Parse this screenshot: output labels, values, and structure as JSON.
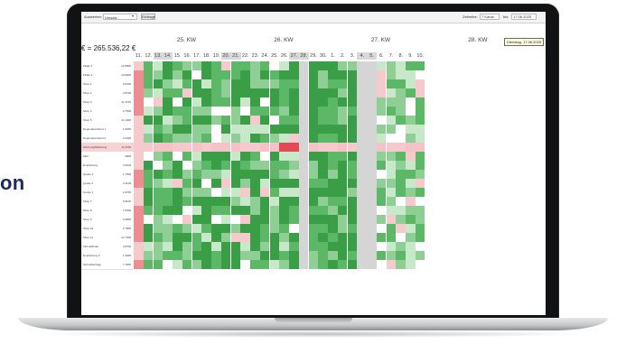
{
  "side_text": "on",
  "toolbar": {
    "label": "Auswerten:",
    "select_value": "Umsatz",
    "button": "Einfrage",
    "right_label": "Zeitreihe:",
    "right_select": "7 Kanal",
    "date_label": "bis:",
    "date_value": "17.06.2025"
  },
  "total": "€ = 265.536,22 €",
  "tooltip": "Dienstag, 17.06.2025",
  "weeks": [
    {
      "label": "25. KW",
      "col": 5
    },
    {
      "label": "26. KW",
      "col": 15
    },
    {
      "label": "27. KW",
      "col": 25
    },
    {
      "label": "28. KW",
      "col": 35
    }
  ],
  "days": [
    "11.",
    "12.",
    "13.",
    "14.",
    "15.",
    "16.",
    "17.",
    "18.",
    "19.",
    "20.",
    "21.",
    "22.",
    "23.",
    "24.",
    "25.",
    "26.",
    "27.",
    "28.",
    "29.",
    "30.",
    "1.",
    "2.",
    "3.",
    "4.",
    "5.",
    "6.",
    "7.",
    "8.",
    "9.",
    "10."
  ],
  "rows": [
    {
      "name": "Filiale 1",
      "value": "14.880€"
    },
    {
      "name": "Filiale 2",
      "value": "10.890€"
    },
    {
      "name": "Shop 1",
      "value": "9.630€"
    },
    {
      "name": "Shop 2",
      "value": "4.870€"
    },
    {
      "name": "Shop 3",
      "value": "11.470€"
    },
    {
      "name": "Shop 4",
      "value": "3.750€"
    },
    {
      "name": "Shop 5",
      "value": "11.440€"
    },
    {
      "name": "Regionalverband 1",
      "value": "1.840€"
    },
    {
      "name": "Regionalverband 2",
      "value": "3.340€"
    },
    {
      "name": "Werbung/Marketing",
      "value": "11.670€"
    },
    {
      "name": "Mail",
      "value": "980€"
    },
    {
      "name": "Empfehlung",
      "value": "4.610€"
    },
    {
      "name": "Quelle 1",
      "value": "1.750€"
    },
    {
      "name": "Quelle 2",
      "value": "3.410€"
    },
    {
      "name": "Kunde 1",
      "value": "2.670€"
    },
    {
      "name": "Shop 7",
      "value": "9.910€"
    },
    {
      "name": "Shop 8",
      "value": "7.530€"
    },
    {
      "name": "Shop 9",
      "value": "3.080€"
    },
    {
      "name": "Shop 10",
      "value": "2.780€"
    },
    {
      "name": "Shop 11",
      "value": "12.720€"
    },
    {
      "name": "Schnellfinder",
      "value": "3.870€"
    },
    {
      "name": "Empfehlung 2",
      "value": "1.300€"
    },
    {
      "name": "Schnellanfrage",
      "value": "7.190€"
    }
  ],
  "colors": {
    "strong_green": "#3a9e46",
    "mid_green": "#5cb766",
    "light_green": "#8fcf95",
    "pale_green": "#c7e8c9",
    "pale_red": "#f6c9cc",
    "mid_red": "#ee8c93",
    "strong_red": "#e24a55",
    "grey": "#d5d5d5",
    "highlight_row": "#f4c3c7"
  }
}
